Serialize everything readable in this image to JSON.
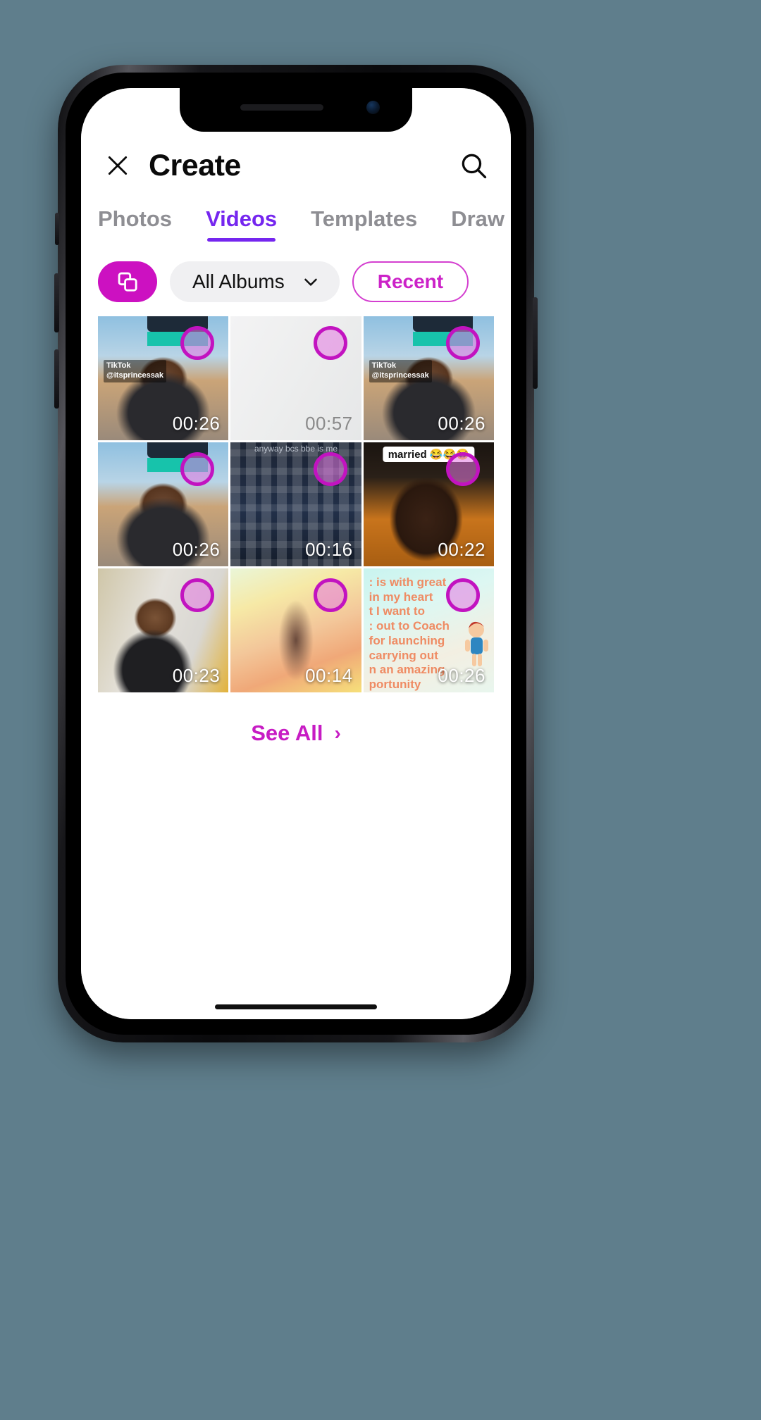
{
  "theme": {
    "background": "#5f7e8c",
    "accent_purple": "#7526ef",
    "accent_magenta": "#cc11c1",
    "chip_border": "#d43fd0"
  },
  "header": {
    "close_icon": "close-icon",
    "title": "Create",
    "search_icon": "search-icon"
  },
  "tabs": [
    {
      "label": "Photos",
      "active": false
    },
    {
      "label": "Videos",
      "active": true
    },
    {
      "label": "Templates",
      "active": false
    },
    {
      "label": "Draw & Color",
      "active": false
    }
  ],
  "filters": {
    "multiselect_icon": "multi-select-icon",
    "album_label": "All Albums",
    "album_chevron_icon": "chevron-down-icon",
    "recent_label": "Recent"
  },
  "media": {
    "tiles": [
      {
        "duration": "00:26",
        "art": "art-girl-outdoor",
        "selected": true,
        "watermark": "TikTok\n@itsprincessak",
        "overlay": "banner"
      },
      {
        "duration": "00:57",
        "art": "art-blank",
        "selected": true,
        "dark_duration": true
      },
      {
        "duration": "00:26",
        "art": "art-girl-outdoor",
        "selected": true,
        "watermark": "TikTok\n@itsprincessak",
        "overlay": "banner"
      },
      {
        "duration": "00:26",
        "art": "art-girl-outdoor",
        "selected": true,
        "overlay": "banner"
      },
      {
        "duration": "00:16",
        "art": "art-dark-ui",
        "selected": true,
        "scrolltext": "anyway bcs bbe is me"
      },
      {
        "duration": "00:22",
        "art": "art-orange-man",
        "selected": true,
        "caption": "married 😂😂😂"
      },
      {
        "duration": "00:23",
        "art": "art-girl-indoor",
        "selected": true
      },
      {
        "duration": "00:14",
        "art": "art-sunny-street",
        "selected": true
      },
      {
        "duration": "00:26",
        "art": "art-text-card",
        "selected": true,
        "text_lines": [
          ": is with great",
          "in my heart",
          "t I want to",
          ": out to Coach",
          "for launching",
          "carrying out",
          "n an amazing",
          "portunity"
        ]
      }
    ]
  },
  "see_all": {
    "label": "See All",
    "chevron": "›"
  }
}
